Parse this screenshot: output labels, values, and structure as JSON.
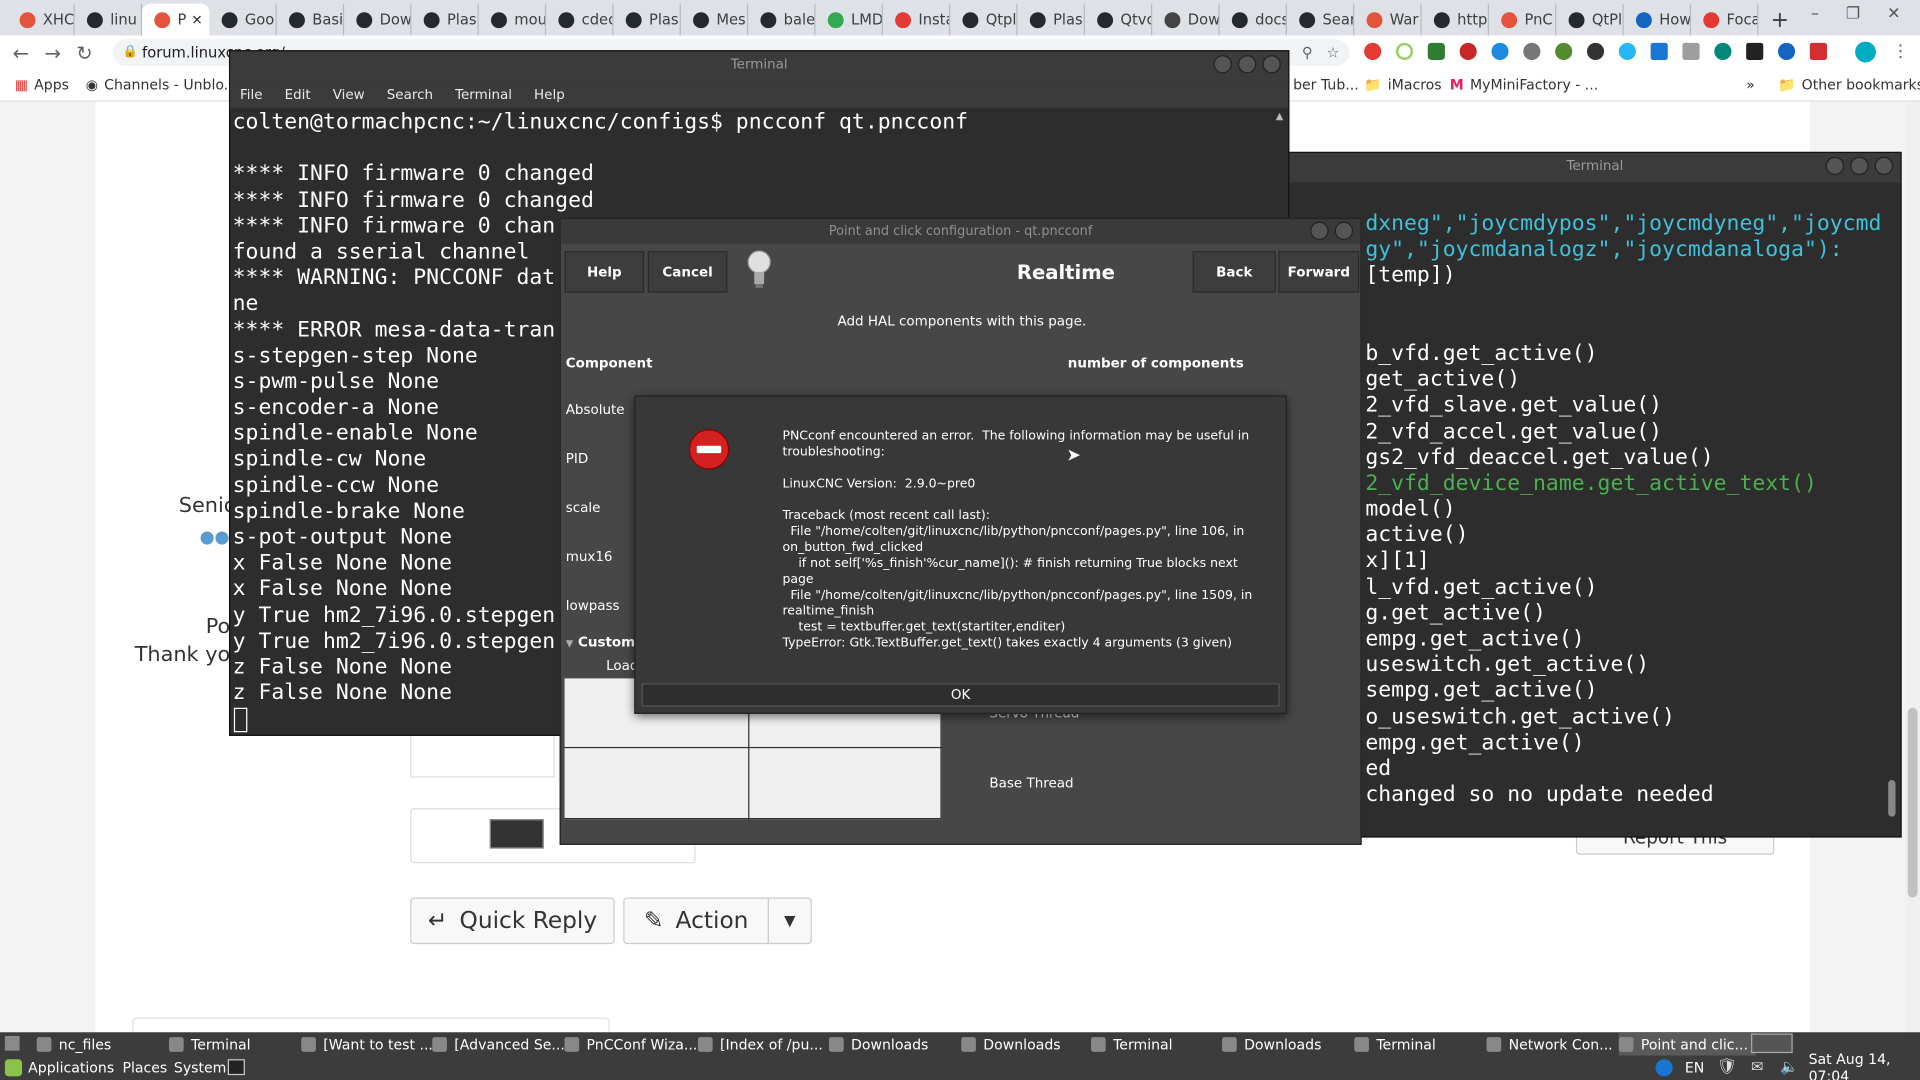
{
  "browser": {
    "tabs": [
      {
        "label": "XHC",
        "color": "#e5533c"
      },
      {
        "label": "linu",
        "color": "#24292e"
      },
      {
        "label": "P",
        "color": "#e5533c",
        "active": true
      },
      {
        "label": "Goo",
        "color": "#24292e"
      },
      {
        "label": "Basi",
        "color": "#24292e"
      },
      {
        "label": "Dow",
        "color": "#24292e"
      },
      {
        "label": "Plas",
        "color": "#24292e"
      },
      {
        "label": "mou",
        "color": "#24292e"
      },
      {
        "label": "cdec",
        "color": "#24292e"
      },
      {
        "label": "Plas",
        "color": "#24292e"
      },
      {
        "label": "Mes",
        "color": "#24292e"
      },
      {
        "label": "bale",
        "color": "#24292e"
      },
      {
        "label": "LMD",
        "color": "#34a853"
      },
      {
        "label": "Insta",
        "color": "#e53935"
      },
      {
        "label": "Qtpl",
        "color": "#24292e"
      },
      {
        "label": "Plas",
        "color": "#24292e"
      },
      {
        "label": "Qtvc",
        "color": "#24292e"
      },
      {
        "label": "Dow",
        "color": "#444"
      },
      {
        "label": "docs",
        "color": "#24292e"
      },
      {
        "label": "Sear",
        "color": "#24292e"
      },
      {
        "label": "War",
        "color": "#e5533c"
      },
      {
        "label": "http",
        "color": "#24292e"
      },
      {
        "label": "PnC",
        "color": "#e5533c"
      },
      {
        "label": "QtPl",
        "color": "#24292e"
      },
      {
        "label": "How",
        "color": "#1565c0"
      },
      {
        "label": "Foca",
        "color": "#e53935"
      }
    ],
    "new_tab": "+",
    "url": "forum.linuxcnc.org/...",
    "bookmarks": {
      "apps": "Apps",
      "channels": "Channels - Unblo...",
      "youtube": "ber Tub...",
      "imacros": "iMacros",
      "myminifactory": "MyMiniFactory - ...",
      "more": "»",
      "other": "Other bookmarks"
    }
  },
  "forum": {
    "senior_label": "Senic",
    "post_label": "Po",
    "thanks_label": "Thank yo",
    "quick_reply": "Quick Reply",
    "action": "Action",
    "report": "Report This"
  },
  "terminal_left": {
    "title": "Terminal",
    "menu": [
      "File",
      "Edit",
      "View",
      "Search",
      "Terminal",
      "Help"
    ],
    "lines": [
      "colten@tormachpcnc:~/linuxcnc/configs$ pncconf qt.pncconf",
      "",
      "**** INFO firmware 0 changed",
      "**** INFO firmware 0 changed",
      "**** INFO firmware 0 chan",
      "found a sserial channel",
      "**** WARNING: PNCCONF dat",
      "ne",
      "**** ERROR mesa-data-tran",
      "s-stepgen-step None",
      "s-pwm-pulse None",
      "s-encoder-a None",
      "spindle-enable None",
      "spindle-cw None",
      "spindle-ccw None",
      "spindle-brake None",
      "s-pot-output None",
      "x False None None",
      "x False None None",
      "y True hm2_7i96.0.stepgen",
      "y True hm2_7i96.0.stepgen",
      "z False None None",
      "z False None None"
    ]
  },
  "terminal_right": {
    "title": "Terminal",
    "lines": [
      {
        "t": "dxneg\",\"joycmdypos\",\"joycmdyneg\",\"joycmd",
        "c": "#3fc1d9"
      },
      {
        "t": "gy\",\"joycmdanalogz\",\"joycmdanaloga\"):",
        "c": "#3fc1d9"
      },
      {
        "t": "[temp])",
        "c": "#ffffff"
      },
      {
        "t": "",
        "c": "#ffffff"
      },
      {
        "t": "",
        "c": "#ffffff"
      },
      {
        "t": "b_vfd.get_active()",
        "c": "#ffffff"
      },
      {
        "t": "get_active()",
        "c": "#ffffff"
      },
      {
        "t": "2_vfd_slave.get_value()",
        "c": "#ffffff"
      },
      {
        "t": "2_vfd_accel.get_value()",
        "c": "#ffffff"
      },
      {
        "t": "gs2_vfd_deaccel.get_value()",
        "c": "#ffffff"
      },
      {
        "t": "2_vfd_device_name.get_active_text()",
        "c": "#4caf50"
      },
      {
        "t": "model()",
        "c": "#ffffff"
      },
      {
        "t": "active()",
        "c": "#ffffff"
      },
      {
        "t": "x][1]",
        "c": "#ffffff"
      },
      {
        "t": "l_vfd.get_active()",
        "c": "#ffffff"
      },
      {
        "t": "g.get_active()",
        "c": "#ffffff"
      },
      {
        "t": "empg.get_active()",
        "c": "#ffffff"
      },
      {
        "t": "useswitch.get_active()",
        "c": "#ffffff"
      },
      {
        "t": "sempg.get_active()",
        "c": "#ffffff"
      },
      {
        "t": "o_useswitch.get_active()",
        "c": "#ffffff"
      },
      {
        "t": "empg.get_active()",
        "c": "#ffffff"
      },
      {
        "t": "ed",
        "c": "#ffffff"
      },
      {
        "t": "changed so no update needed",
        "c": "#ffffff"
      }
    ]
  },
  "pncconf": {
    "title": "Point and click configuration - qt.pncconf",
    "help": "Help",
    "cancel": "Cancel",
    "heading": "Realtime",
    "back": "Back",
    "forward": "Forward",
    "subtitle": "Add HAL components with this page.",
    "component_header": "Component",
    "count_header": "number of components",
    "components": [
      "Absolute",
      "PID",
      "scale",
      "mux16",
      "lowpass"
    ],
    "custom": "Custom C",
    "load": "Load",
    "servo_thread": "Servo Thread",
    "base_thread": "Base Thread"
  },
  "error_dialog": {
    "text": "PNCconf encountered an error.  The following information may be useful in\ntroubleshooting:\n\nLinuxCNC Version:  2.9.0~pre0\n\nTraceback (most recent call last):\n  File \"/home/colten/git/linuxcnc/lib/python/pncconf/pages.py\", line 106, in\non_button_fwd_clicked\n    if not self['%s_finish'%cur_name](): # finish returning True blocks next page\n  File \"/home/colten/git/linuxcnc/lib/python/pncconf/pages.py\", line 1509, in\nrealtime_finish\n    test = textbuffer.get_text(startiter,enditer)\nTypeError: Gtk.TextBuffer.get_text() takes exactly 4 arguments (3 given)",
    "ok": "OK"
  },
  "taskbar": {
    "top": [
      {
        "label": "nc_files"
      },
      {
        "label": "Terminal"
      },
      {
        "label": "[Want to test ..."
      },
      {
        "label": "[Advanced Se..."
      },
      {
        "label": "PnCConf Wiza..."
      },
      {
        "label": "[Index of /pu..."
      },
      {
        "label": "Downloads"
      },
      {
        "label": "Downloads"
      },
      {
        "label": "Terminal"
      },
      {
        "label": "Downloads"
      },
      {
        "label": "Terminal"
      },
      {
        "label": "Network Con..."
      },
      {
        "label": "Point and clic..."
      }
    ],
    "applications": "Applications",
    "places": "Places",
    "system": "System",
    "lang": "EN",
    "clock": "Sat Aug 14, 07:04"
  }
}
